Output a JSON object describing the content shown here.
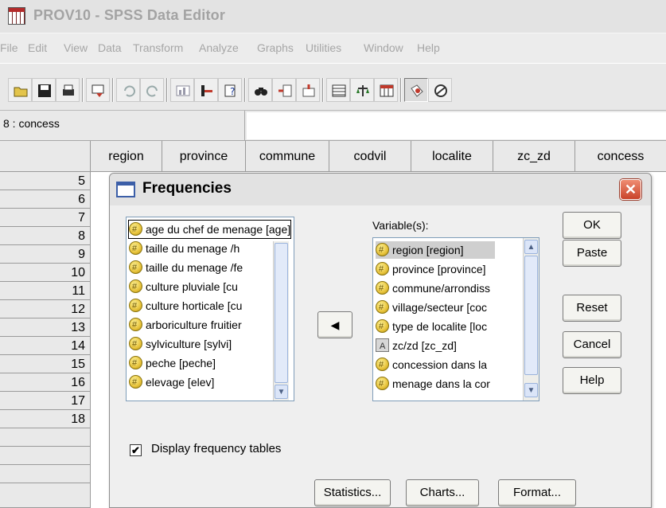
{
  "window": {
    "title": "PROV10 - SPSS Data Editor"
  },
  "menubar": [
    "File",
    "Edit",
    "View",
    "Data",
    "Transform",
    "Analyze",
    "Graphs",
    "Utilities",
    "Window",
    "Help"
  ],
  "toolbar": {
    "icons": [
      "open-folder-icon",
      "save-icon",
      "print-icon",
      "dialog-recall-icon",
      "undo-icon",
      "redo-icon",
      "goto-chart-icon",
      "goto-case-icon",
      "variables-icon",
      "find-icon",
      "insert-case-icon",
      "insert-variable-icon",
      "split-file-icon",
      "weight-cases-icon",
      "select-cases-icon",
      "value-labels-icon",
      "use-sets-icon"
    ]
  },
  "cellbar": {
    "reference": "8 : concess",
    "value": ""
  },
  "grid": {
    "columns": [
      "region",
      "province",
      "commune",
      "codvil",
      "localite",
      "zc_zd",
      "concess"
    ],
    "rows": [
      "5",
      "6",
      "7",
      "8",
      "9",
      "10",
      "11",
      "12",
      "13",
      "14",
      "15",
      "16",
      "17",
      "18"
    ]
  },
  "dialog": {
    "title": "Frequencies",
    "source_list": [
      "age du chef de menage [age]",
      "taille du menage /h",
      "taille du menage /fe",
      "culture pluviale [cu",
      "culture horticale [cu",
      "arboriculture fruitier",
      "sylviculture [sylvi]",
      "peche [peche]",
      "elevage [elev]"
    ],
    "move_button": "◀",
    "variables_label": "Variable(s):",
    "target_list": [
      {
        "label": "region [region]",
        "type": "numeric"
      },
      {
        "label": "province [province]",
        "type": "numeric"
      },
      {
        "label": "commune/arrondiss",
        "type": "numeric"
      },
      {
        "label": "village/secteur [coc",
        "type": "numeric"
      },
      {
        "label": "type de localite [loc",
        "type": "numeric"
      },
      {
        "label": "zc/zd [zc_zd]",
        "type": "string"
      },
      {
        "label": "concession dans la",
        "type": "numeric"
      },
      {
        "label": "menage dans la cor",
        "type": "numeric"
      }
    ],
    "buttons": {
      "ok": "OK",
      "paste": "Paste",
      "reset": "Reset",
      "cancel": "Cancel",
      "help": "Help"
    },
    "checkbox": {
      "label": "Display frequency tables",
      "checked": true,
      "mark": "✔"
    },
    "bottom_buttons": {
      "statistics": "Statistics...",
      "charts": "Charts...",
      "format": "Format..."
    },
    "close_glyph": "✕"
  }
}
